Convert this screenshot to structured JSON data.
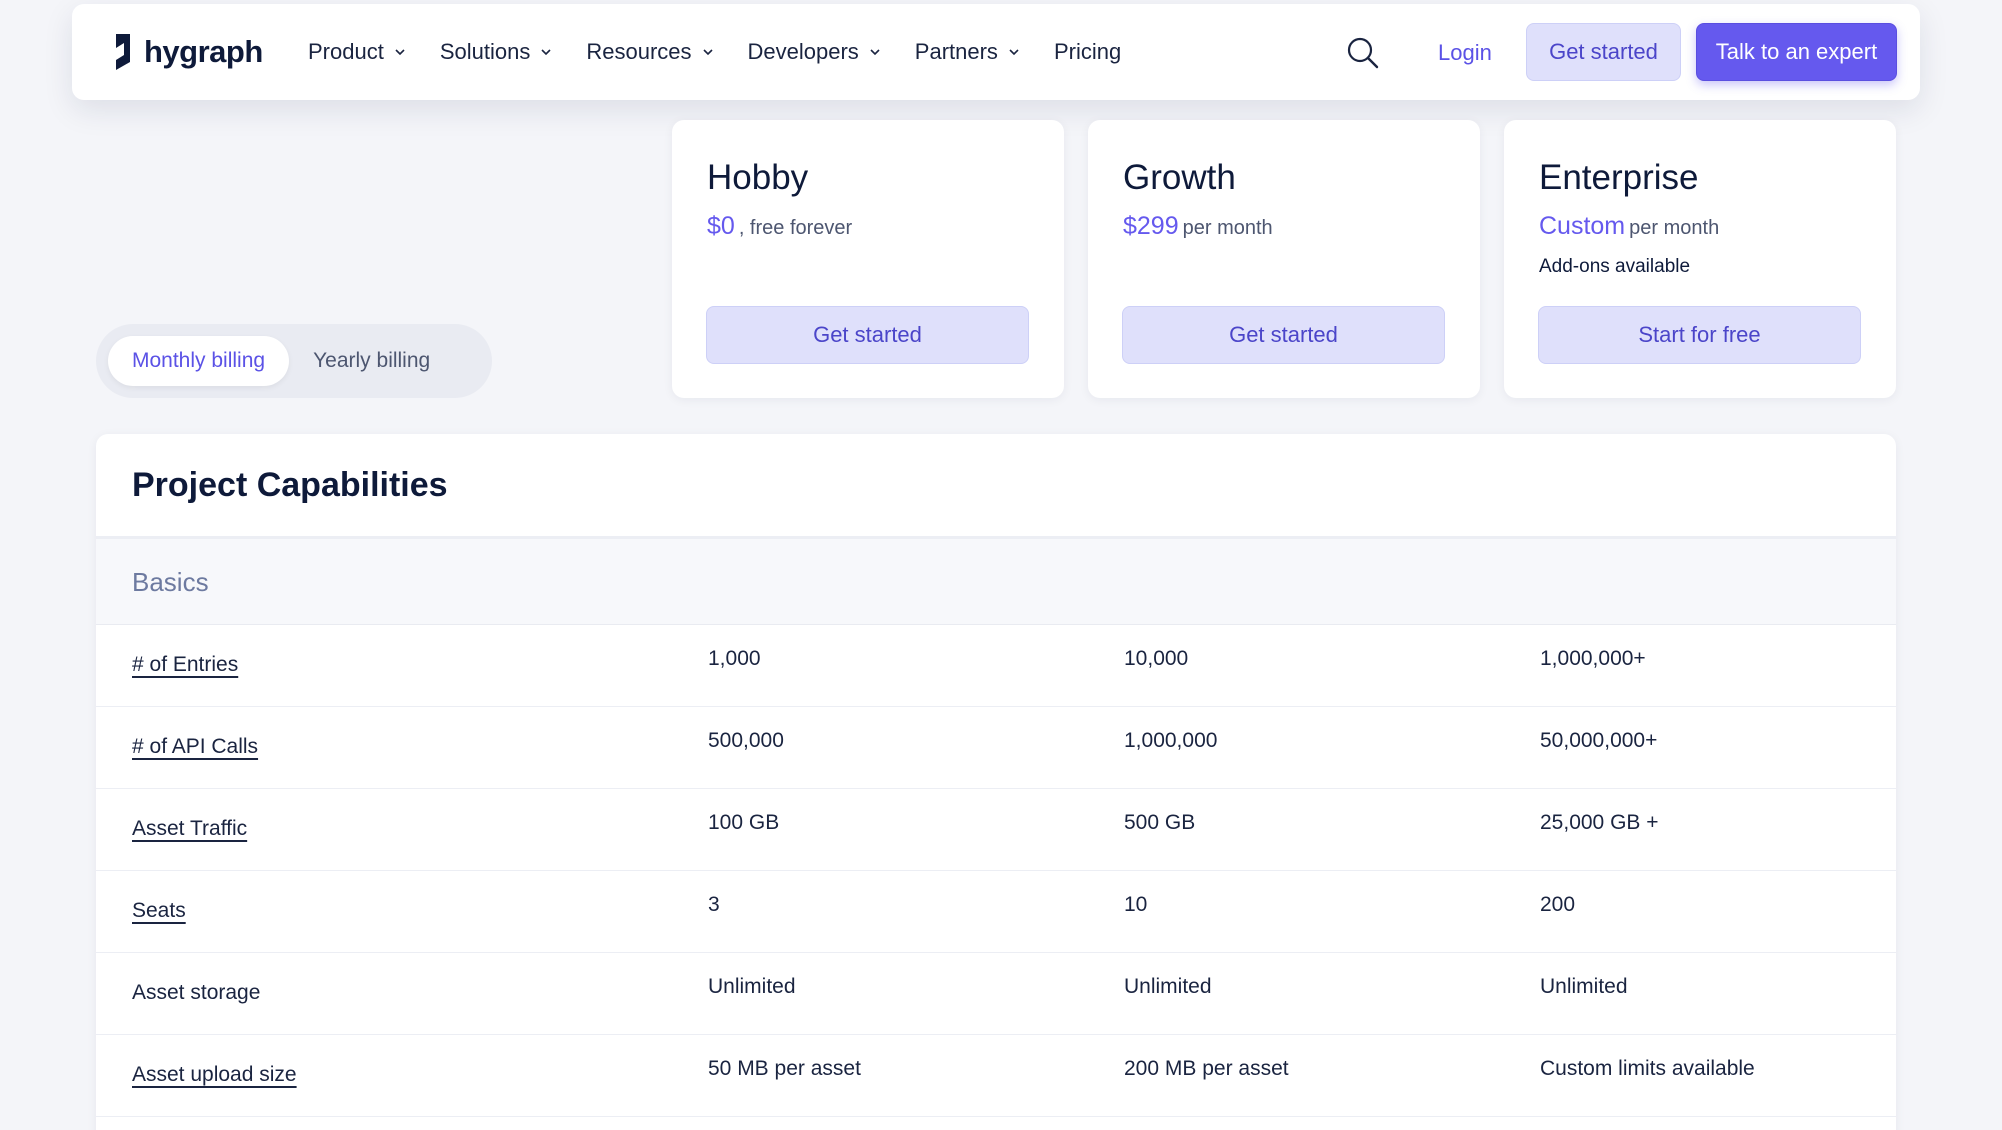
{
  "nav": {
    "logo_text": "hygraph",
    "items": [
      {
        "label": "Product",
        "has_menu": true
      },
      {
        "label": "Solutions",
        "has_menu": true
      },
      {
        "label": "Resources",
        "has_menu": true
      },
      {
        "label": "Developers",
        "has_menu": true
      },
      {
        "label": "Partners",
        "has_menu": true
      },
      {
        "label": "Pricing",
        "has_menu": false
      }
    ],
    "search_icon": "search-icon",
    "login_label": "Login",
    "get_started_label": "Get started",
    "expert_label": "Talk to an expert"
  },
  "billing": {
    "monthly_label": "Monthly billing",
    "yearly_label": "Yearly billing",
    "selected": "monthly"
  },
  "plans": [
    {
      "name": "Hobby",
      "price": "$0",
      "price_suffix": ", free forever",
      "addon": "",
      "cta": "Get started"
    },
    {
      "name": "Growth",
      "price": "$299",
      "price_suffix": "per month",
      "addon": "",
      "cta": "Get started"
    },
    {
      "name": "Enterprise",
      "price": "Custom",
      "price_suffix": "per month",
      "addon": "Add-ons available",
      "cta": "Start for free"
    }
  ],
  "capabilities": {
    "title": "Project Capabilities",
    "section": "Basics",
    "rows": [
      {
        "label": "# of Entries",
        "link": true,
        "values": [
          "1,000",
          "10,000",
          "1,000,000+"
        ]
      },
      {
        "label": "# of API Calls",
        "link": true,
        "values": [
          "500,000",
          "1,000,000",
          "50,000,000+"
        ]
      },
      {
        "label": "Asset Traffic",
        "link": true,
        "values": [
          "100 GB",
          "500 GB",
          "25,000 GB +"
        ]
      },
      {
        "label": "Seats",
        "link": true,
        "values": [
          "3",
          "10",
          "200"
        ]
      },
      {
        "label": "Asset storage",
        "link": false,
        "values": [
          "Unlimited",
          "Unlimited",
          "Unlimited"
        ]
      },
      {
        "label": "Asset upload size",
        "link": true,
        "values": [
          "50 MB per asset",
          "200 MB per asset",
          "Custom limits available"
        ]
      }
    ]
  },
  "colors": {
    "accent": "#6559ee",
    "accent_soft": "#dfe0fb",
    "text": "#0e1a3a",
    "background": "#f4f5f9"
  }
}
